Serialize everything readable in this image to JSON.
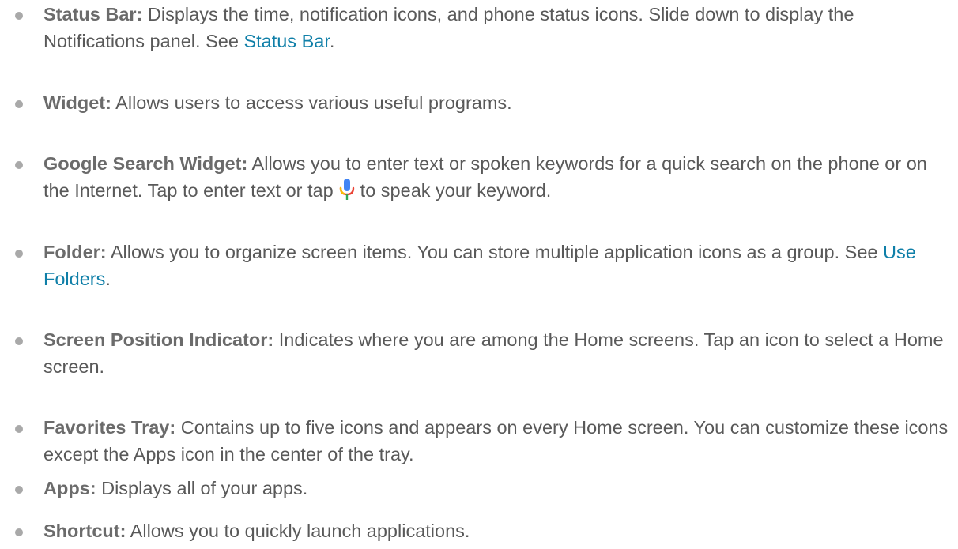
{
  "items": [
    {
      "term": "Status Bar:",
      "desc_pre": " Displays the time, notification icons, and phone status icons. Slide down to display the Notifications panel. See ",
      "link": "Status Bar",
      "desc_post": "."
    },
    {
      "term": "Widget:",
      "desc": " Allows users to access various useful programs."
    },
    {
      "term": "Google Search Widget:",
      "desc_pre": " Allows you to enter text or spoken keywords for a quick search on the phone or on the Internet. Tap to enter text or tap",
      "icon": "microphone-icon",
      "desc_post": "to speak your keyword."
    },
    {
      "term": "Folder:",
      "desc_pre": " Allows you to organize screen items. You can store multiple application icons as a group. See ",
      "link": "Use Folders",
      "desc_post": "."
    },
    {
      "term": "Screen Position Indicator:",
      "desc": " Indicates where you are among the Home screens. Tap an icon to select a Home screen."
    },
    {
      "term": "Favorites Tray:",
      "desc": " Contains up to five icons and appears on every Home screen. You can customize these icons except the Apps icon in the center of the tray."
    },
    {
      "term": "Apps:",
      "desc": " Displays all of your apps."
    },
    {
      "term": "Shortcut:",
      "desc": " Allows you to quickly launch applications."
    }
  ],
  "colors": {
    "text": "#595959",
    "term": "#6b6b6b",
    "link": "#0f7fa8",
    "bullet": "#a9a9a9"
  }
}
